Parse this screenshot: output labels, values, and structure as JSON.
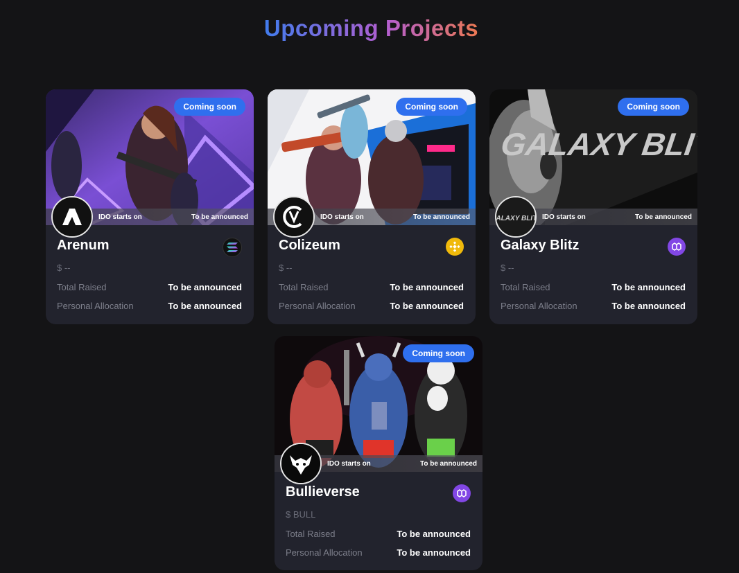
{
  "page": {
    "title": "Upcoming Projects"
  },
  "common": {
    "badge": "Coming soon",
    "ido_label": "IDO starts on",
    "ido_value": "To be announced",
    "total_raised_label": "Total Raised",
    "allocation_label": "Personal Allocation"
  },
  "projects": [
    {
      "name": "Arenum",
      "ticker": "$ --",
      "total_raised": "To be announced",
      "allocation": "To be announced",
      "chain_icon": "solana-icon",
      "logo_text": ""
    },
    {
      "name": "Colizeum",
      "ticker": "$ --",
      "total_raised": "To be announced",
      "allocation": "To be announced",
      "chain_icon": "bnb-icon",
      "logo_text": ""
    },
    {
      "name": "Galaxy Blitz",
      "ticker": "$ --",
      "total_raised": "To be announced",
      "allocation": "To be announced",
      "chain_icon": "polygon-icon",
      "logo_text": "GALAXY BLITZ",
      "banner_text": "GALAXY BLITZ"
    },
    {
      "name": "Bullieverse",
      "ticker": "$ BULL",
      "total_raised": "To be announced",
      "allocation": "To be announced",
      "chain_icon": "polygon-icon",
      "logo_text": ""
    }
  ],
  "colors": {
    "accent": "#2f6fee",
    "card_bg": "#22232d",
    "page_bg": "#141416"
  }
}
